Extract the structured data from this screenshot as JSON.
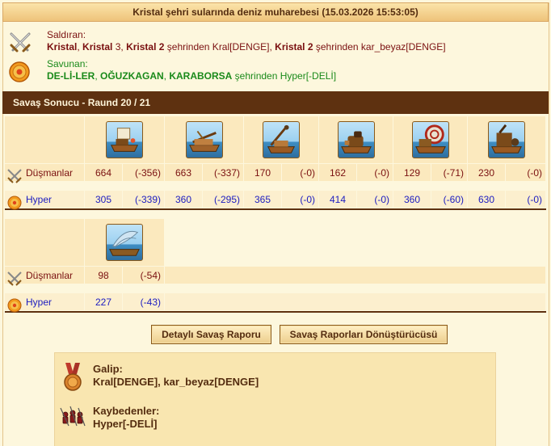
{
  "window": {
    "title": "Kristal şehri sularında deniz muharebesi (15.03.2026 15:53:05)"
  },
  "attacker": {
    "label": "Saldıran:",
    "line": [
      {
        "text": "Kristal",
        "bold": true
      },
      {
        "text": ", ",
        "bold": false
      },
      {
        "text": "Kristal",
        "bold": true
      },
      {
        "text": " 3, ",
        "bold": false
      },
      {
        "text": "Kristal 2",
        "bold": true
      },
      {
        "text": " şehrinden Kral[DENGE], ",
        "bold": false
      },
      {
        "text": "Kristal 2",
        "bold": true
      },
      {
        "text": " şehrinden kar_beyaz[DENGE]",
        "bold": false
      }
    ]
  },
  "defender": {
    "label": "Savunan:",
    "line": [
      {
        "text": "DE-Lİ-LER",
        "bold": true
      },
      {
        "text": ", ",
        "bold": false
      },
      {
        "text": "OĞUZKAGAN",
        "bold": true
      },
      {
        "text": ", ",
        "bold": false
      },
      {
        "text": "KARABORSA",
        "bold": true
      },
      {
        "text": " şehrinden Hyper[-DELİ]",
        "bold": false
      }
    ]
  },
  "section": {
    "title": "Savaş Sonucu - Raund 20 / 21"
  },
  "rows": {
    "enemies_label": "Düşmanlar",
    "hyper_label": "Hyper"
  },
  "units_block1": [
    {
      "icon": "fire-ship-icon",
      "enemy_count": "664",
      "enemy_loss": "(-356)",
      "hyper_count": "305",
      "hyper_loss": "(-339)"
    },
    {
      "icon": "ballista-ship-icon",
      "enemy_count": "663",
      "enemy_loss": "(-337)",
      "hyper_count": "360",
      "hyper_loss": "(-295)"
    },
    {
      "icon": "catapult-ship-icon",
      "enemy_count": "170",
      "enemy_loss": "(-0)",
      "hyper_count": "365",
      "hyper_loss": "(-0)"
    },
    {
      "icon": "mortar-ship-icon",
      "enemy_count": "162",
      "enemy_loss": "(-0)",
      "hyper_count": "414",
      "hyper_loss": "(-0)"
    },
    {
      "icon": "wheel-ship-icon",
      "enemy_count": "129",
      "enemy_loss": "(-71)",
      "hyper_count": "360",
      "hyper_loss": "(-60)"
    },
    {
      "icon": "paddle-ship-icon",
      "enemy_count": "230",
      "enemy_loss": "(-0)",
      "hyper_count": "630",
      "hyper_loss": "(-0)"
    }
  ],
  "units_block2": [
    {
      "icon": "sail-ship-icon",
      "enemy_count": "98",
      "enemy_loss": "(-54)",
      "hyper_count": "227",
      "hyper_loss": "(-43)"
    }
  ],
  "buttons": {
    "detailed_report": "Detaylı Savaş Raporu",
    "report_converter": "Savaş Raporları Dönüştürücüsü"
  },
  "result": {
    "winner_title": "Galip:",
    "winner_value": "Kral[DENGE], kar_beyaz[DENGE]",
    "loser_title": "Kaybedenler:",
    "loser_value": "Hyper[-DELİ]"
  },
  "colors": {
    "attacker_text": "#7a1010",
    "defender_text": "#1a8a1a",
    "hyper_text": "#1c1cc0",
    "section_bar": "#5e3110"
  }
}
